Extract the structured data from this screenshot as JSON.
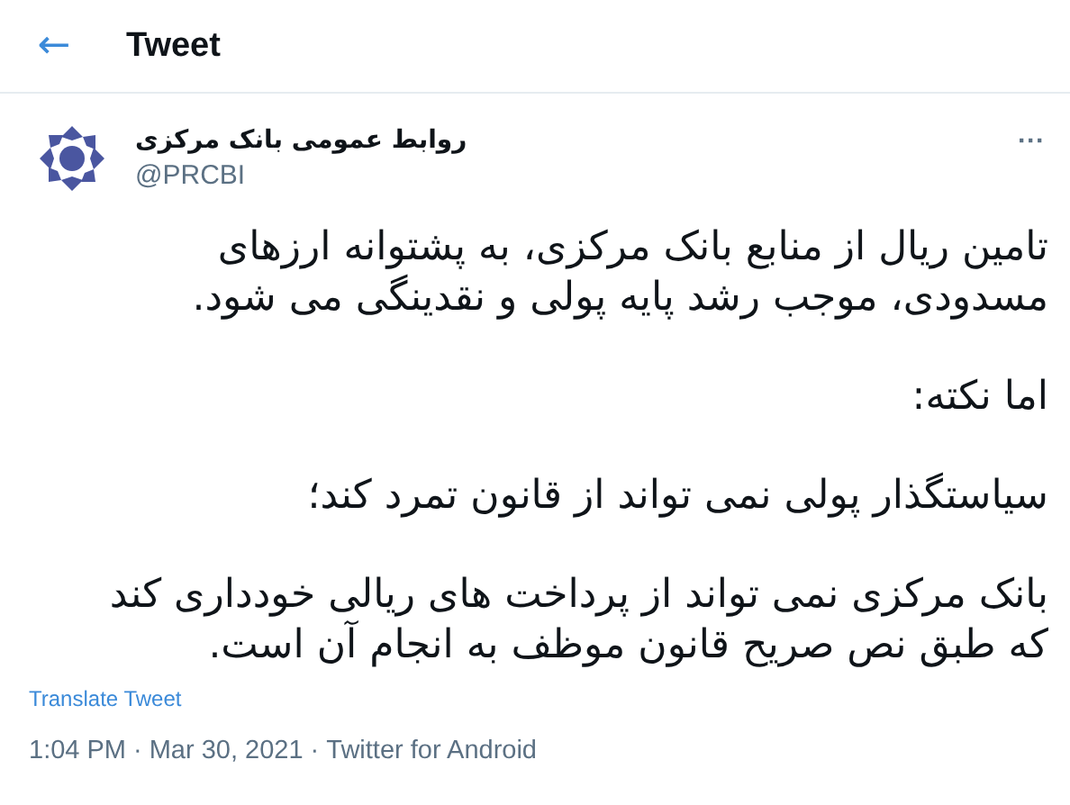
{
  "header": {
    "back": "←",
    "title": "Tweet"
  },
  "author": {
    "name": "روابط عمومی بانک مرکزی",
    "handle": "@PRCBI",
    "more": "···"
  },
  "paragraphs": [
    "تامین ریال از منابع بانک مرکزی، به پشتوانه ارزهای مسدودی، موجب رشد پایه پولی و نقدینگی می شود.",
    "اما نکته:",
    "سیاستگذار پولی نمی تواند از قانون تمرد کند؛",
    "بانک مرکزی نمی تواند از پرداخت های ریالی خودداری کند که طبق نص صریح قانون موظف به انجام آن است."
  ],
  "translate": "Translate Tweet",
  "meta": {
    "time": "1:04 PM",
    "sep1": "·",
    "date": "Mar 30, 2021",
    "sep2": "·",
    "source": "Twitter for Android"
  }
}
